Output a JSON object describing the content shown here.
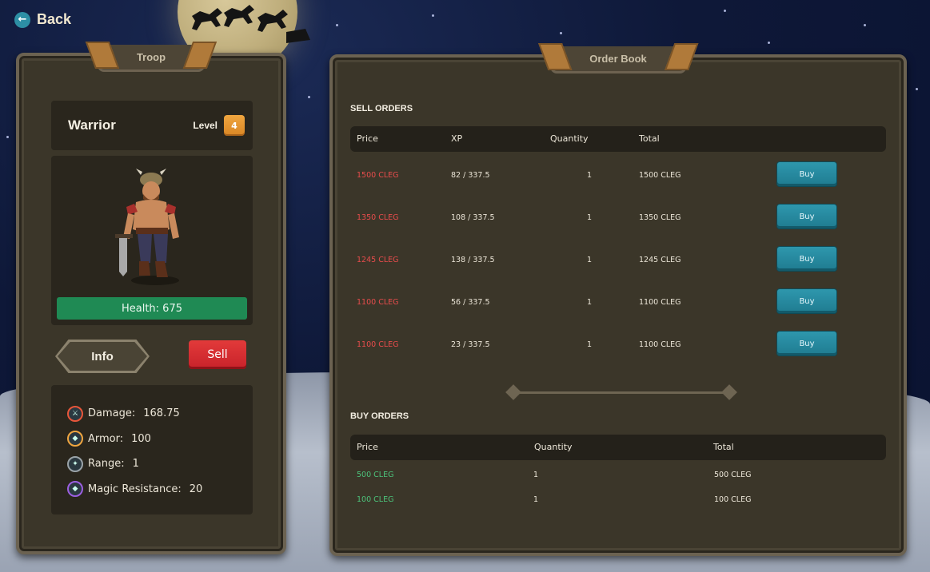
{
  "back_label": "Back",
  "troop_panel": {
    "title": "Troop",
    "troop_name": "Warrior",
    "level_label": "Level",
    "level_value": "4",
    "health_text": "Health: 675",
    "info_label": "Info",
    "sell_label": "Sell",
    "stats": [
      {
        "label": "Damage:",
        "value": "168.75",
        "icon": "sword-icon",
        "color": "#e8563a"
      },
      {
        "label": "Armor:",
        "value": "100",
        "icon": "shield-icon",
        "color": "#f0a640"
      },
      {
        "label": "Range:",
        "value": "1",
        "icon": "target-icon",
        "color": "#9aa3a8"
      },
      {
        "label": "Magic Resistance:",
        "value": "20",
        "icon": "magic-shield-icon",
        "color": "#9b5fe0"
      }
    ]
  },
  "order_book": {
    "title": "Order Book",
    "sell_title": "SELL ORDERS",
    "sell_headers": {
      "price": "Price",
      "xp": "XP",
      "quantity": "Quantity",
      "total": "Total"
    },
    "sell_rows": [
      {
        "price": "1500 CLEG",
        "xp": "82 / 337.5",
        "quantity": "1",
        "total": "1500 CLEG",
        "action": "Buy"
      },
      {
        "price": "1350 CLEG",
        "xp": "108 / 337.5",
        "quantity": "1",
        "total": "1350 CLEG",
        "action": "Buy"
      },
      {
        "price": "1245 CLEG",
        "xp": "138 / 337.5",
        "quantity": "1",
        "total": "1245 CLEG",
        "action": "Buy"
      },
      {
        "price": "1100 CLEG",
        "xp": "56 / 337.5",
        "quantity": "1",
        "total": "1100 CLEG",
        "action": "Buy"
      },
      {
        "price": "1100 CLEG",
        "xp": "23 / 337.5",
        "quantity": "1",
        "total": "1100 CLEG",
        "action": "Buy"
      }
    ],
    "buy_title": "BUY ORDERS",
    "buy_headers": {
      "price": "Price",
      "quantity": "Quantity",
      "total": "Total"
    },
    "buy_rows": [
      {
        "price": "500 CLEG",
        "quantity": "1",
        "total": "500 CLEG"
      },
      {
        "price": "100 CLEG",
        "quantity": "1",
        "total": "100 CLEG"
      }
    ]
  },
  "colors": {
    "sell_price": "#e84c4c",
    "buy_price": "#4cc27a",
    "buy_button": "#2e97ad",
    "sell_button": "#d42a2f",
    "health_bar": "#1f8a54",
    "level_badge": "#e8962f"
  }
}
